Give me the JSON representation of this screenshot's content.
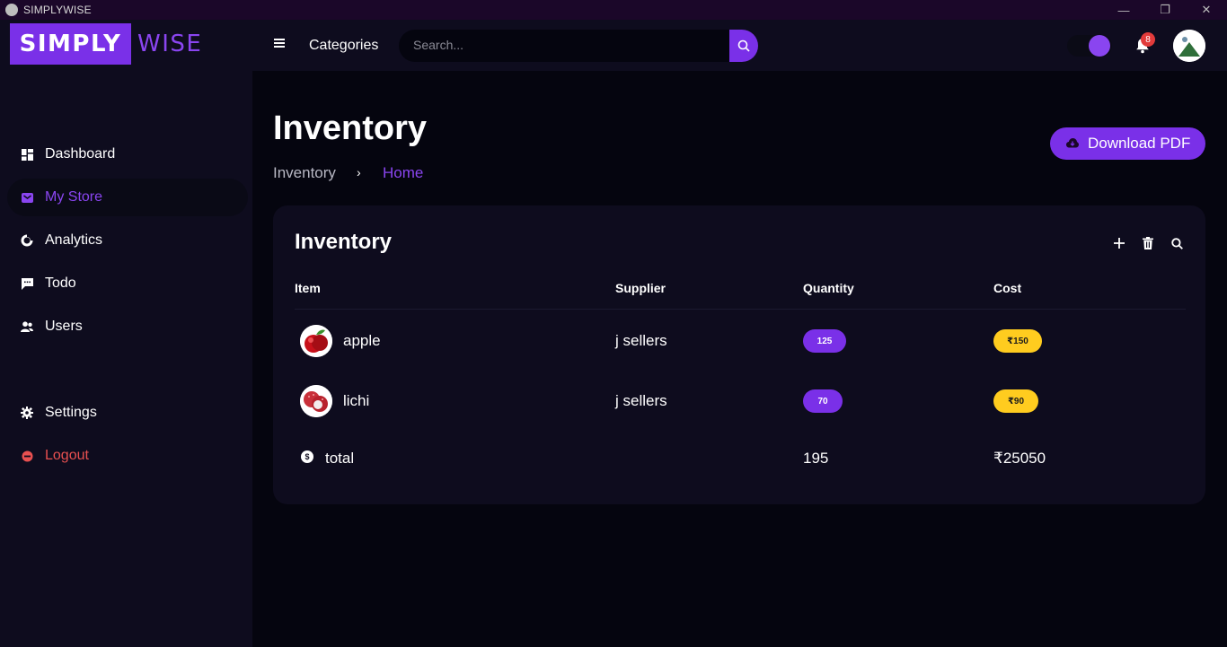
{
  "window": {
    "title": "SIMPLYWISE"
  },
  "header": {
    "logo_part1": "SIMPLY",
    "logo_part2": "WISE",
    "categories_label": "Categories",
    "search_placeholder": "Search...",
    "notification_count": "8"
  },
  "sidebar": {
    "items": [
      {
        "label": "Dashboard",
        "icon": "dashboard-icon"
      },
      {
        "label": "My Store",
        "icon": "store-icon",
        "active": true
      },
      {
        "label": "Analytics",
        "icon": "analytics-icon"
      },
      {
        "label": "Todo",
        "icon": "todo-icon"
      },
      {
        "label": "Users",
        "icon": "users-icon"
      },
      {
        "label": "Settings",
        "icon": "gear-icon"
      },
      {
        "label": "Logout",
        "icon": "logout-icon"
      }
    ]
  },
  "page": {
    "title": "Inventory",
    "breadcrumb": [
      "Inventory",
      "Home"
    ],
    "download_label": "Download PDF"
  },
  "card": {
    "title": "Inventory",
    "columns": [
      "Item",
      "Supplier",
      "Quantity",
      "Cost"
    ],
    "rows": [
      {
        "item": "apple",
        "supplier": "j sellers",
        "quantity": "125",
        "cost": "₹150"
      },
      {
        "item": "lichi",
        "supplier": "j sellers",
        "quantity": "70",
        "cost": "₹90"
      }
    ],
    "total": {
      "label": "total",
      "quantity": "195",
      "cost": "₹25050"
    }
  },
  "colors": {
    "accent": "#7a30e8",
    "accent_text": "#8a45f0",
    "cost_badge": "#ffcc1f",
    "logout": "#e85050",
    "notification_badge": "#e23b3b"
  }
}
